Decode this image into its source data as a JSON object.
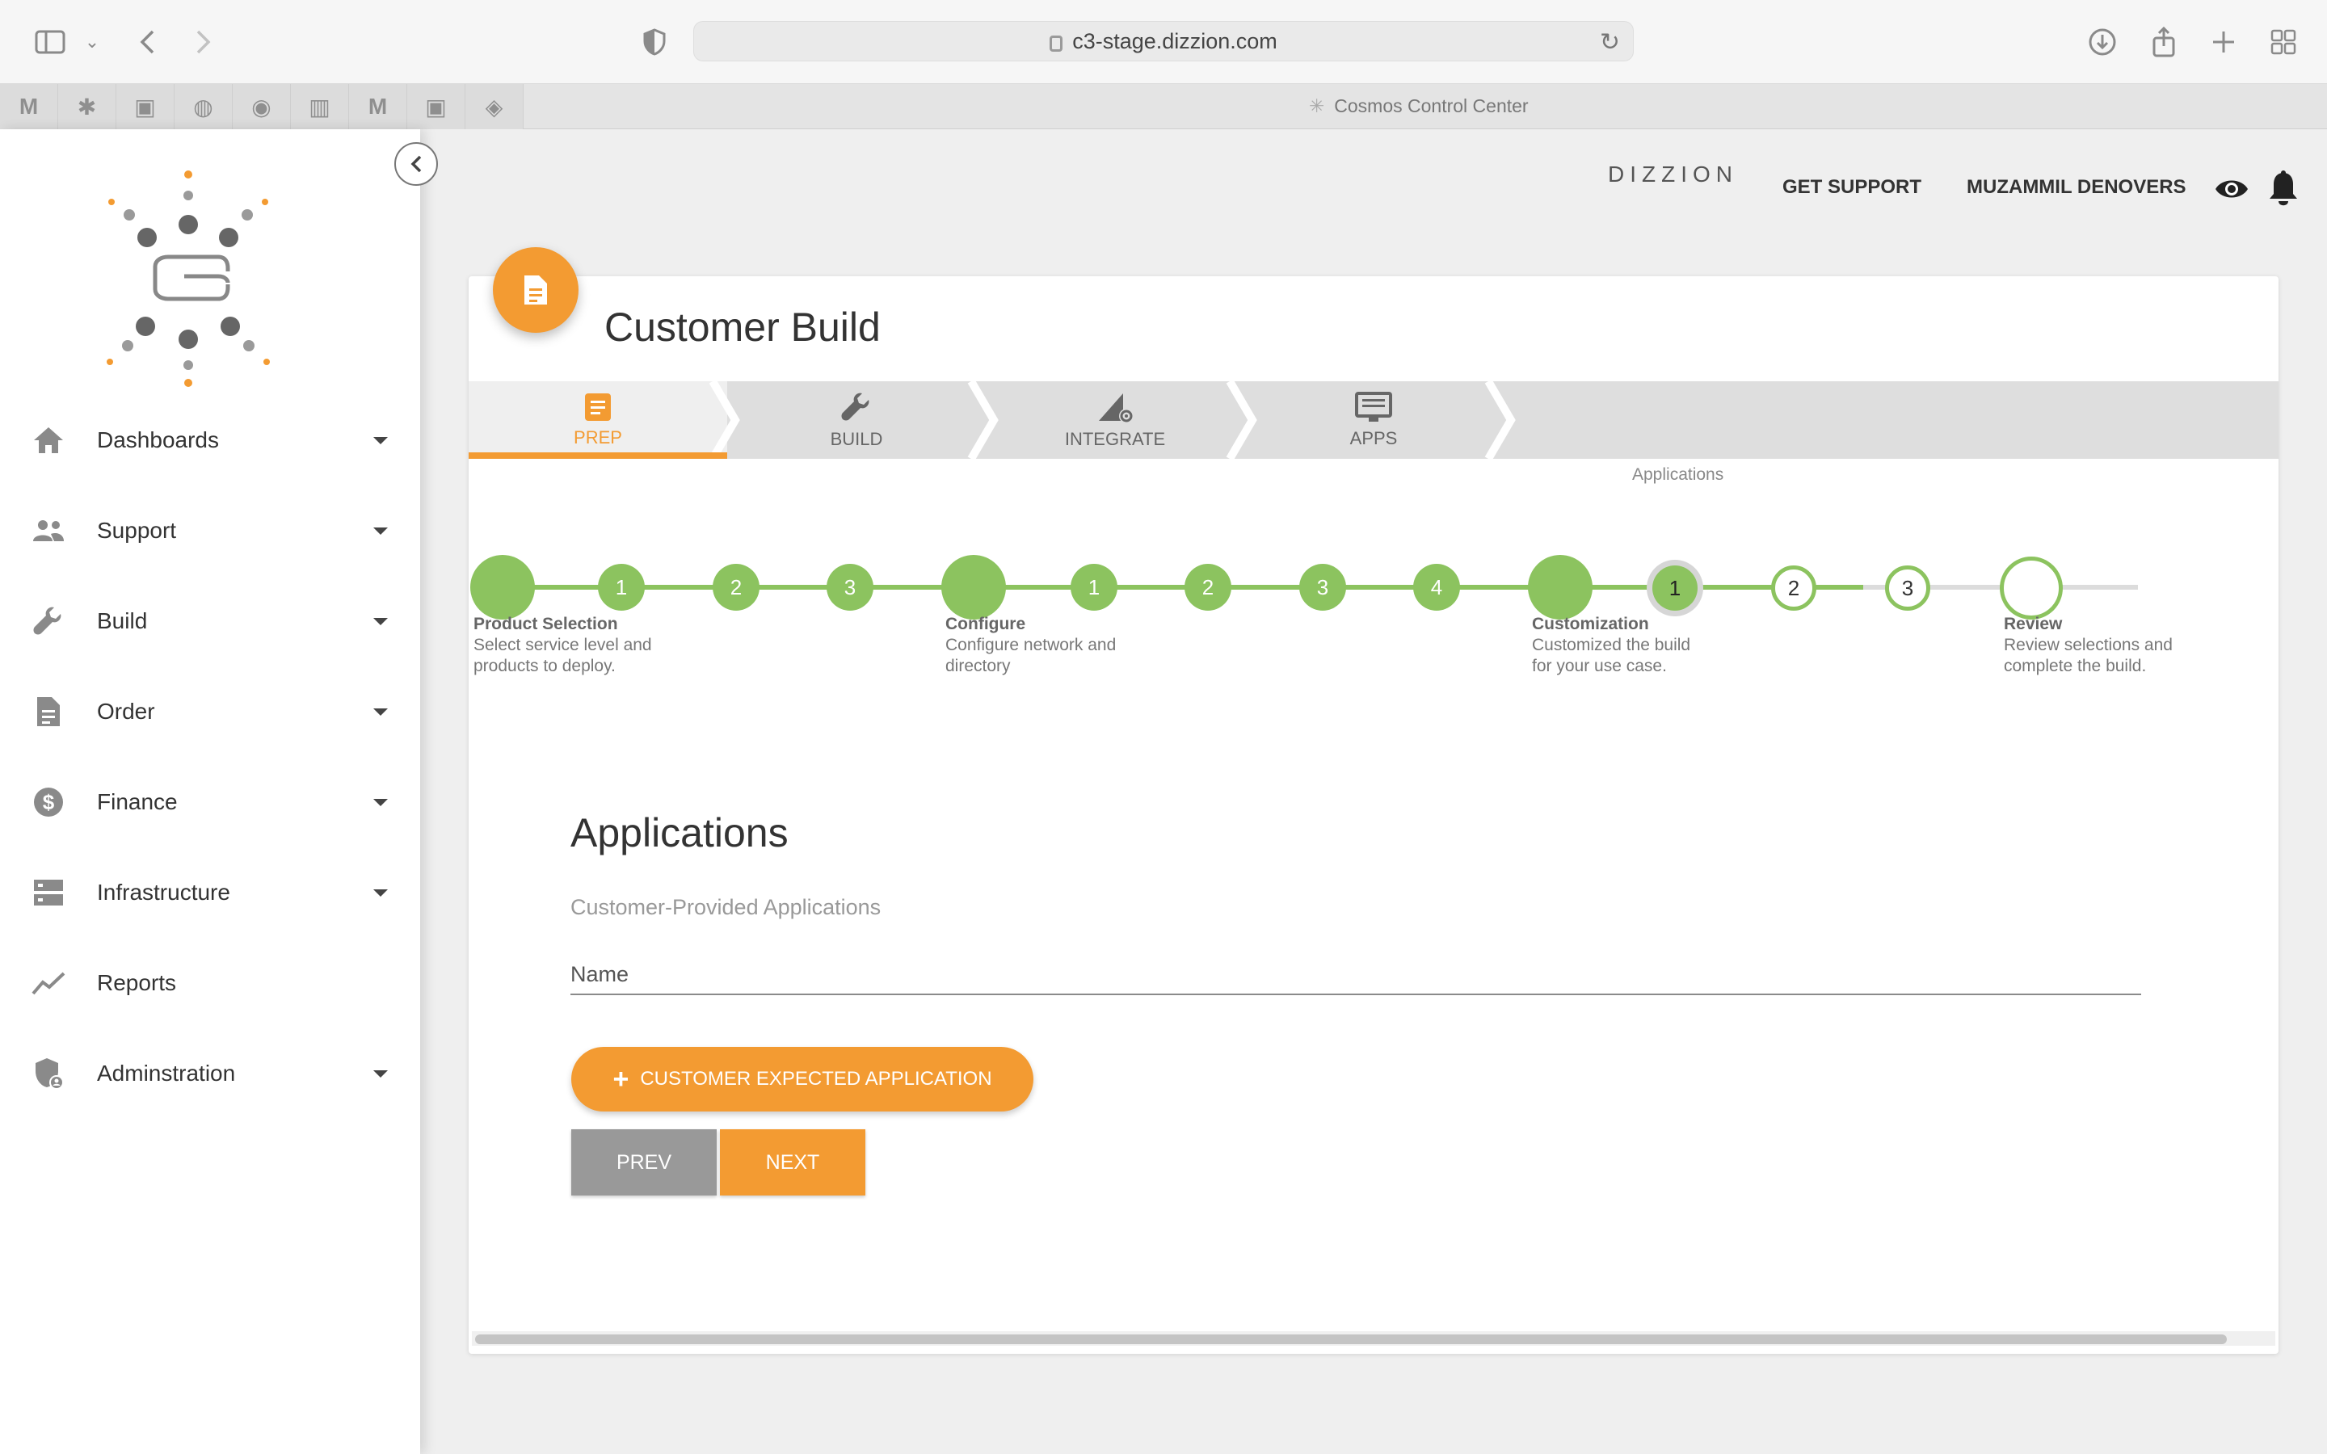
{
  "browser": {
    "url": "c3-stage.dizzion.com",
    "tab_title": "Cosmos Control Center"
  },
  "sidebar": {
    "items": [
      {
        "label": "Dashboards",
        "icon": "home-icon",
        "has_menu": true
      },
      {
        "label": "Support",
        "icon": "people-icon",
        "has_menu": true
      },
      {
        "label": "Build",
        "icon": "wrench-icon",
        "has_menu": true
      },
      {
        "label": "Order",
        "icon": "document-icon",
        "has_menu": true
      },
      {
        "label": "Finance",
        "icon": "dollar-icon",
        "has_menu": true
      },
      {
        "label": "Infrastructure",
        "icon": "server-icon",
        "has_menu": true
      },
      {
        "label": "Reports",
        "icon": "chart-line-icon",
        "has_menu": false
      },
      {
        "label": "Adminstration",
        "icon": "shield-user-icon",
        "has_menu": true
      }
    ]
  },
  "header": {
    "brand": "DIZZION",
    "support_label": "GET SUPPORT",
    "user_name": "MUZAMMIL DENOVERS"
  },
  "card": {
    "title": "Customer Build",
    "tabs": [
      {
        "label": "PREP",
        "active": true
      },
      {
        "label": "BUILD",
        "active": false
      },
      {
        "label": "INTEGRATE",
        "active": false
      },
      {
        "label": "APPS",
        "active": false
      }
    ],
    "tab_sub_label": "Applications"
  },
  "stepper": {
    "dots": [
      "",
      "1",
      "2",
      "3",
      "",
      "1",
      "2",
      "3",
      "4",
      "",
      "1",
      "2",
      "3",
      ""
    ],
    "captions": [
      {
        "title": "Product Selection",
        "desc1": "Select service level and",
        "desc2": "products to deploy."
      },
      {
        "title": "Configure",
        "desc1": "Configure network and",
        "desc2": "directory"
      },
      {
        "title": "Customization",
        "desc1": "Customized the build",
        "desc2": "for your use case."
      },
      {
        "title": "Review",
        "desc1": "Review selections and",
        "desc2": "complete the build."
      }
    ]
  },
  "form": {
    "section_title": "Applications",
    "section_subtitle": "Customer-Provided Applications",
    "name_placeholder": "Name",
    "add_button_label": "CUSTOMER EXPECTED APPLICATION",
    "prev_label": "PREV",
    "next_label": "NEXT"
  },
  "colors": {
    "accent": "#f39b32",
    "step_green": "#8cc35f",
    "sidebar_bg": "#ffffff"
  }
}
